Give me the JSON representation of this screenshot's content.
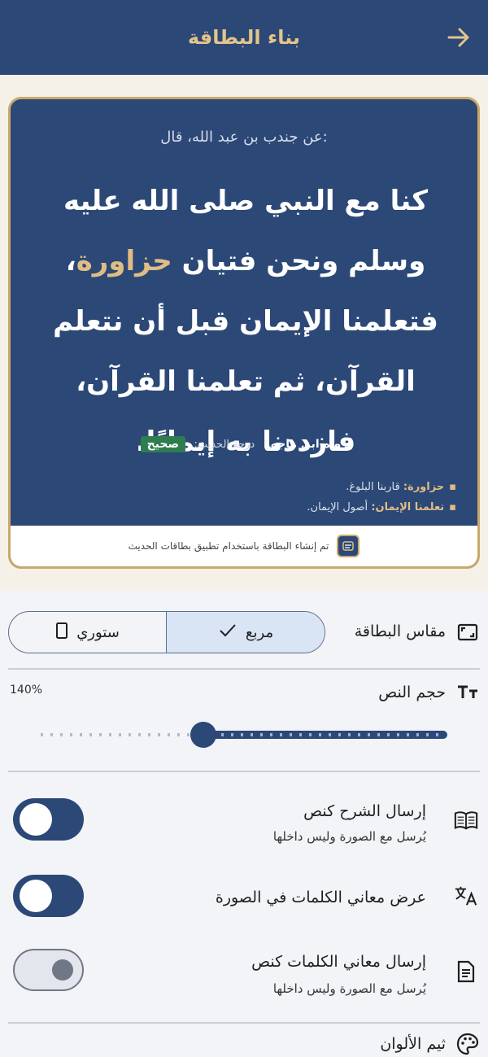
{
  "header": {
    "title": "بناء البطاقة"
  },
  "card": {
    "narrator": "عن جندب بن عبد الله، قال:",
    "hadith_part1": "كنا مع النبي صلى الله عليه وسلم ونحن فتيان ",
    "hadith_highlight": "حزاورة",
    "hadith_part2": "، فتعلمنا الإيمان قبل أن نتعلم القرآن، ثم تعلمنا القرآن، فازددنا به إيمانًا.",
    "source": "رواه ابن ماجه",
    "source_sep": "،",
    "grade_label": "درجة الحديث:",
    "grade": "صحيح",
    "glossary": [
      {
        "term": "حزاورة:",
        "meaning": "قاربنا البلوغ."
      },
      {
        "term": "تعلمنا الإيمان:",
        "meaning": "أصول الإيمان."
      }
    ],
    "footer_text": "تم إنشاء البطاقة باستخدام تطبيق بطاقات الحديث"
  },
  "settings": {
    "size_label": "مقاس البطاقة",
    "size_options": [
      "مربع",
      "ستوري"
    ],
    "selected_size": "مربع",
    "text_size_label": "حجم النص",
    "text_size_value": "140%",
    "text_size_fraction": 0.4,
    "toggles": [
      {
        "label": "إرسال الشرح كنص",
        "sub": "يُرسل مع الصورة وليس داخلها",
        "on": true
      },
      {
        "label": "عرض معاني الكلمات في الصورة",
        "sub": "",
        "on": true
      },
      {
        "label": "إرسال معاني الكلمات كنص",
        "sub": "يُرسل مع الصورة وليس داخلها",
        "on": false
      }
    ],
    "theme_label": "ثيم الألوان"
  },
  "colors": {
    "primary": "#2b4877",
    "gold": "#c9a86a",
    "highlight": "#e0bd84",
    "grade_green": "#2e7d4f"
  }
}
